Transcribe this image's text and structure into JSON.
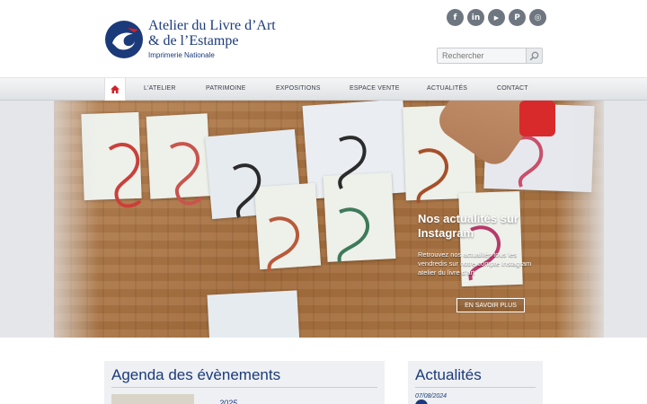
{
  "brand": {
    "line1": "Atelier du Livre d’Art",
    "line2": "& de l’Estampe",
    "sub": "Imprimerie Nationale"
  },
  "social": [
    {
      "name": "facebook",
      "glyph": "f"
    },
    {
      "name": "linkedin",
      "glyph": "in"
    },
    {
      "name": "youtube",
      "glyph": "▶"
    },
    {
      "name": "pinterest",
      "glyph": "P"
    },
    {
      "name": "instagram",
      "glyph": "◎"
    }
  ],
  "search": {
    "placeholder": "Rechercher"
  },
  "nav": {
    "items": [
      "L'ATELIER",
      "PATRIMOINE",
      "EXPOSITIONS",
      "ESPACE VENTE",
      "ACTUALITÉS",
      "CONTACT"
    ]
  },
  "hero": {
    "title": "Nos actualités sur Instagram",
    "text": "Retrouvez nos actualités tous les vendredis sur notre compte Instagram atelier du livre d'art",
    "button": "EN SAVOIR PLUS"
  },
  "agenda": {
    "title": "Agenda des évènements",
    "year": "2025"
  },
  "news": {
    "title": "Actualités",
    "date": "07/08/2024"
  },
  "colors": {
    "brand_blue": "#1b3a7a",
    "accent_red": "#d2232a",
    "social_grey": "#6e7680"
  }
}
